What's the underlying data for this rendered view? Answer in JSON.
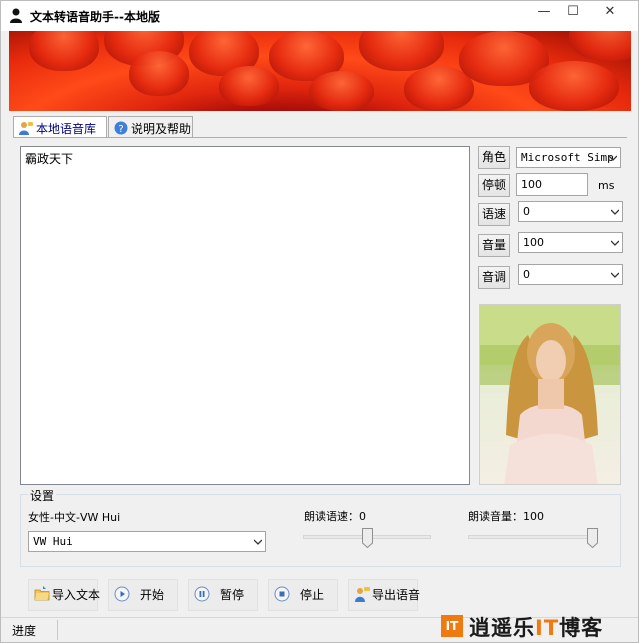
{
  "window": {
    "title": "文本转语音助手--本地版",
    "minimize_glyph": "—",
    "maximize_glyph": "☐",
    "close_glyph": "✕"
  },
  "tabs": [
    {
      "label": "本地语音库",
      "icon": "user-speech-icon",
      "active": true
    },
    {
      "label": "说明及帮助",
      "icon": "help-icon",
      "active": false
    }
  ],
  "editor": {
    "text": "霸政天下"
  },
  "controls": {
    "role": {
      "label": "角色",
      "value": "Microsoft Simp"
    },
    "pause": {
      "label": "停顿",
      "value": "100",
      "unit": "ms"
    },
    "speed": {
      "label": "语速",
      "value": "0"
    },
    "volume": {
      "label": "音量",
      "value": "100"
    },
    "pitch": {
      "label": "音调",
      "value": "0"
    }
  },
  "settings": {
    "title": "设置",
    "voice_name": "女性-中文-VW Hui",
    "voice_select": "VW Hui",
    "rate_label": "朗读语速：0",
    "volume_label": "朗读音量：100",
    "rate_level": 0.5,
    "volume_level": 1.0
  },
  "actions": {
    "import": "导入文本",
    "start": "开始",
    "pause": "暂停",
    "stop": "停止",
    "export": "导出语音"
  },
  "status": {
    "progress_label": "进度"
  },
  "watermark": {
    "logo": "IT",
    "text_a": "逍遥乐",
    "text_b": "IT",
    "text_c": "博客"
  },
  "colors": {
    "accent": "#f07a12",
    "tab_active_text": "#000080",
    "banner_red": "#e0260e"
  }
}
